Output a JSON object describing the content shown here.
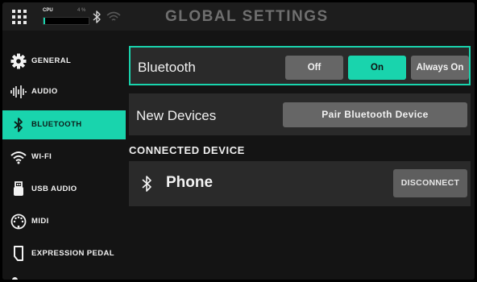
{
  "header": {
    "title": "GLOBAL SETTINGS",
    "cpu_label": "CPU",
    "cpu_percent_text": "4 %",
    "cpu_level": 0.04,
    "icons": [
      "grid-menu-icon",
      "bluetooth-icon",
      "wifi-icon"
    ]
  },
  "sidebar": {
    "items": [
      {
        "label": "GENERAL",
        "icon": "gear-icon"
      },
      {
        "label": "AUDIO",
        "icon": "waveform-icon"
      },
      {
        "label": "BLUETOOTH",
        "icon": "bluetooth-icon",
        "active": true
      },
      {
        "label": "WI-FI",
        "icon": "wifi-icon"
      },
      {
        "label": "USB AUDIO",
        "icon": "usb-icon"
      },
      {
        "label": "MIDI",
        "icon": "midi-icon"
      },
      {
        "label": "EXPRESSION PEDAL",
        "icon": "expression-pedal-icon"
      }
    ]
  },
  "bluetooth_row": {
    "label": "Bluetooth",
    "options": [
      "Off",
      "On",
      "Always On"
    ],
    "selected": "On"
  },
  "new_devices_row": {
    "label": "New Devices",
    "button": "Pair Bluetooth Device"
  },
  "connected": {
    "heading": "CONNECTED DEVICE",
    "device_name": "Phone",
    "device_icon": "bluetooth-icon",
    "button": "DISCONNECT"
  },
  "colors": {
    "accent": "#19d4ad",
    "button_gray": "#666666",
    "row_bg": "#2a2a2a",
    "background": "#141414"
  }
}
